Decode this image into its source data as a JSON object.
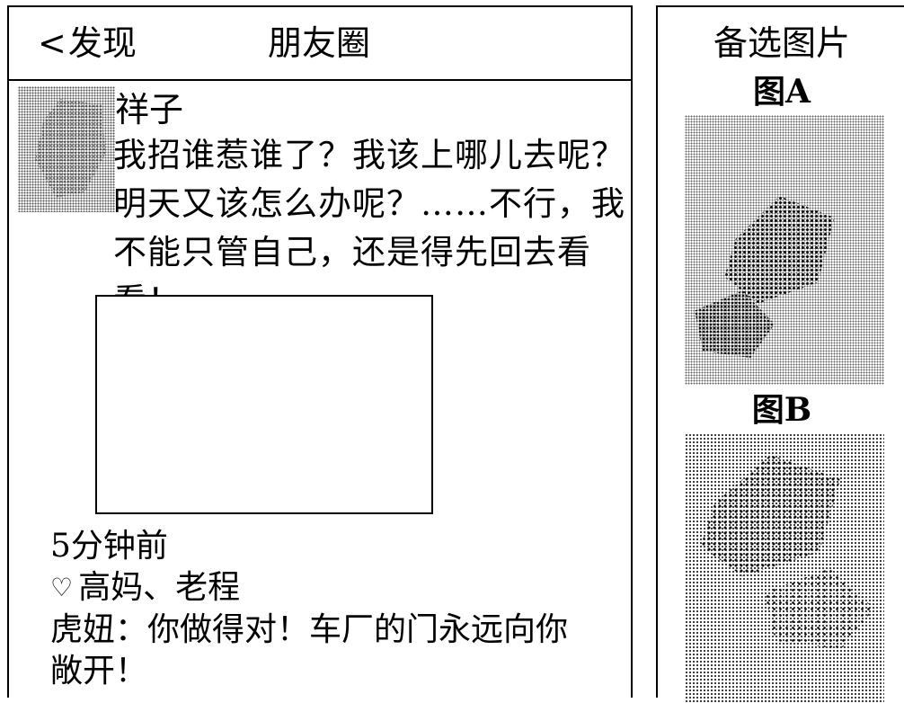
{
  "nav": {
    "back_chevron": "<",
    "back_label": "发现",
    "title": "朋友圈"
  },
  "post": {
    "author": "祥子",
    "text": "我招谁惹谁了？我该上哪儿去呢？明天又该怎么办呢？……不行，我不能只管自己，还是得先回去看看！",
    "time": "5分钟前",
    "heart_icon": "♡",
    "likes": "高妈、老程",
    "comment": "虎妞：你做得对！车厂的门永远向你敞开！"
  },
  "options": {
    "title": "备选图片",
    "image_a_label": "图A",
    "image_b_label": "图B"
  }
}
